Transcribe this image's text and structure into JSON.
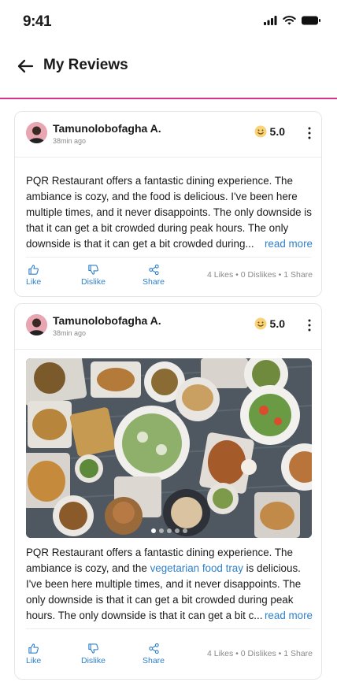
{
  "status": {
    "time": "9:41"
  },
  "header": {
    "title": "My Reviews"
  },
  "reviews": [
    {
      "author": "Tamunolobofagha A.",
      "time_ago": "38min ago",
      "rating": "5.0",
      "text": "PQR Restaurant offers a fantastic dining experience. The ambiance is cozy, and the food is delicious. I've been here multiple times, and it never disappoints. The only downside is that it can get a bit crowded during peak hours. The only downside is that it can get a bit crowded during...",
      "read_more": "read more",
      "actions": {
        "like": "Like",
        "dislike": "Dislike",
        "share": "Share"
      },
      "stats": "4 Likes • 0 Dislikes • 1 Share"
    },
    {
      "author": "Tamunolobofagha A.",
      "time_ago": "38min ago",
      "rating": "5.0",
      "text_before": "PQR Restaurant offers a fantastic dining experience. The ambiance is cozy, and the ",
      "text_link": "vegetarian food tray",
      "text_after": " is delicious. I've been here multiple times, and it never disappoints. The only downside is that it can get a bit crowded during peak hours. The only downside is that it can get a bit c...",
      "read_more": "read more",
      "actions": {
        "like": "Like",
        "dislike": "Dislike",
        "share": "Share"
      },
      "stats": "4 Likes • 0 Dislikes • 1 Share",
      "carousel": {
        "total": 5,
        "active": 1
      }
    }
  ]
}
